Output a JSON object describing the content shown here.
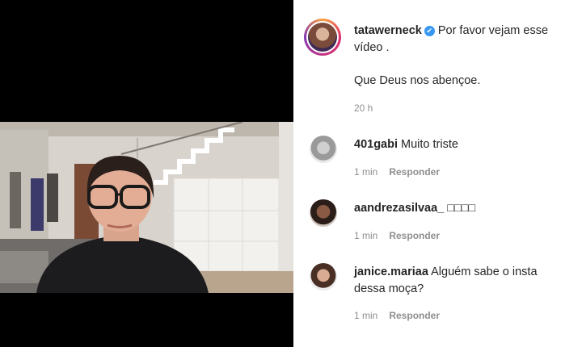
{
  "post": {
    "username": "tatawerneck",
    "caption_line1": "Por favor vejam esse",
    "caption_line2": "vídeo .",
    "caption_line3": "Que Deus nos abençoe.",
    "time": "20 h"
  },
  "comments": [
    {
      "username": "401gabi",
      "text": "Muito triste",
      "time": "1 min",
      "reply_label": "Responder"
    },
    {
      "username": "aandrezasilvaa_",
      "text": "□□□□",
      "time": "1 min",
      "reply_label": "Responder"
    },
    {
      "username": "janice.mariaa",
      "text": "Alguém sabe o insta",
      "text_line2": "dessa moça?",
      "time": "1 min",
      "reply_label": "Responder"
    }
  ],
  "colors": {
    "verified": "#3897f0",
    "meta": "#8e8e8e",
    "text": "#262626"
  }
}
